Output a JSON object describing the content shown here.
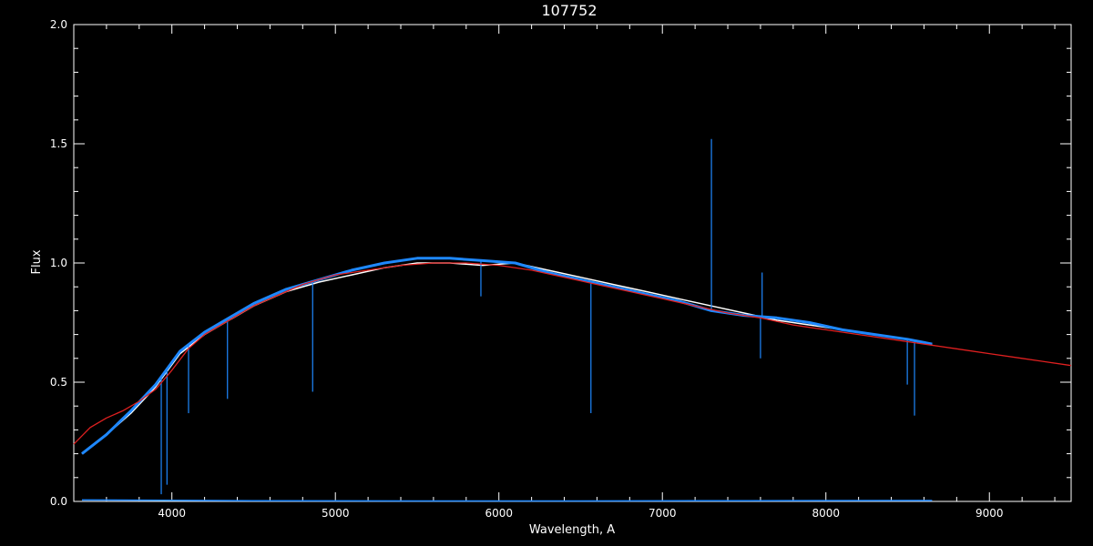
{
  "chart_data": {
    "type": "line",
    "title": "107752",
    "xlabel": "Wavelength, A",
    "ylabel": "Flux",
    "xlim": [
      3400,
      9500
    ],
    "ylim": [
      0,
      2.0
    ],
    "x_ticks": [
      4000,
      5000,
      6000,
      7000,
      8000,
      9000
    ],
    "x_tick_labels": [
      "4000",
      "5000",
      "6000",
      "7000",
      "8000",
      "9000"
    ],
    "y_ticks": [
      0.0,
      0.5,
      1.0,
      1.5,
      2.0
    ],
    "y_tick_labels": [
      "0.0",
      "0.5",
      "1.0",
      "1.5",
      "2.0"
    ],
    "x_minor_step": 200,
    "y_minor_step": 0.1,
    "background_color": "#000000",
    "axis_color": "#ffffff",
    "grid": false,
    "series": [
      {
        "color": "#ffffff",
        "x": [
          3450,
          3600,
          3750,
          3900,
          4050,
          4200,
          4350,
          4500,
          4700,
          4900,
          5100,
          5300,
          5500,
          5700,
          5900,
          6100,
          6300,
          6500,
          6700,
          6900,
          7100,
          7300,
          7500,
          7700,
          7900,
          8100,
          8300,
          8500,
          8650
        ],
        "y": [
          0.2,
          0.28,
          0.37,
          0.48,
          0.62,
          0.7,
          0.76,
          0.82,
          0.88,
          0.92,
          0.95,
          0.98,
          1.0,
          1.0,
          0.99,
          1.0,
          0.97,
          0.94,
          0.91,
          0.88,
          0.85,
          0.82,
          0.79,
          0.76,
          0.74,
          0.72,
          0.7,
          0.68,
          0.66
        ]
      },
      {
        "color": "#1e88ff",
        "x": [
          3450,
          3600,
          3750,
          3900,
          4050,
          4200,
          4350,
          4500,
          4700,
          4900,
          5100,
          5300,
          5500,
          5700,
          5900,
          6100,
          6300,
          6500,
          6700,
          6900,
          7100,
          7300,
          7500,
          7700,
          7900,
          8100,
          8300,
          8500,
          8650
        ],
        "y": [
          0.2,
          0.28,
          0.38,
          0.49,
          0.63,
          0.71,
          0.77,
          0.83,
          0.89,
          0.93,
          0.97,
          1.0,
          1.02,
          1.02,
          1.01,
          1.0,
          0.96,
          0.93,
          0.9,
          0.87,
          0.84,
          0.8,
          0.78,
          0.77,
          0.75,
          0.72,
          0.7,
          0.68,
          0.66
        ],
        "spikes": [
          {
            "x": 3935,
            "y": 0.03
          },
          {
            "x": 3970,
            "y": 0.07
          },
          {
            "x": 4102,
            "y": 0.37
          },
          {
            "x": 4340,
            "y": 0.43
          },
          {
            "x": 4861,
            "y": 0.46
          },
          {
            "x": 5890,
            "y": 0.86
          },
          {
            "x": 6563,
            "y": 0.37
          },
          {
            "x": 7300,
            "y": 1.52
          },
          {
            "x": 7600,
            "y": 0.6
          },
          {
            "x": 7610,
            "y": 0.96
          },
          {
            "x": 8498,
            "y": 0.49
          },
          {
            "x": 8542,
            "y": 0.36
          }
        ]
      },
      {
        "color": "#e02020",
        "x": [
          3400,
          3500,
          3600,
          3700,
          3800,
          3900,
          4000,
          4100,
          4200,
          4300,
          4400,
          4500,
          4600,
          4700,
          4800,
          4900,
          5000,
          5200,
          5400,
          5600,
          5800,
          6000,
          6200,
          6400,
          6600,
          6800,
          7000,
          7200,
          7400,
          7600,
          7800,
          8000,
          8200,
          8400,
          8600,
          8800,
          9000,
          9200,
          9500
        ],
        "y": [
          0.24,
          0.31,
          0.35,
          0.38,
          0.42,
          0.47,
          0.55,
          0.64,
          0.7,
          0.74,
          0.78,
          0.82,
          0.85,
          0.88,
          0.91,
          0.93,
          0.95,
          0.97,
          0.99,
          1.0,
          1.0,
          0.99,
          0.97,
          0.94,
          0.91,
          0.88,
          0.85,
          0.82,
          0.79,
          0.77,
          0.74,
          0.72,
          0.7,
          0.68,
          0.66,
          0.64,
          0.62,
          0.6,
          0.57
        ]
      },
      {
        "color": "#1e88ff",
        "x": [
          3450,
          4500,
          5500,
          6500,
          7500,
          8650
        ],
        "y": [
          0.006,
          0.003,
          0.002,
          0.002,
          0.003,
          0.004
        ]
      }
    ]
  }
}
